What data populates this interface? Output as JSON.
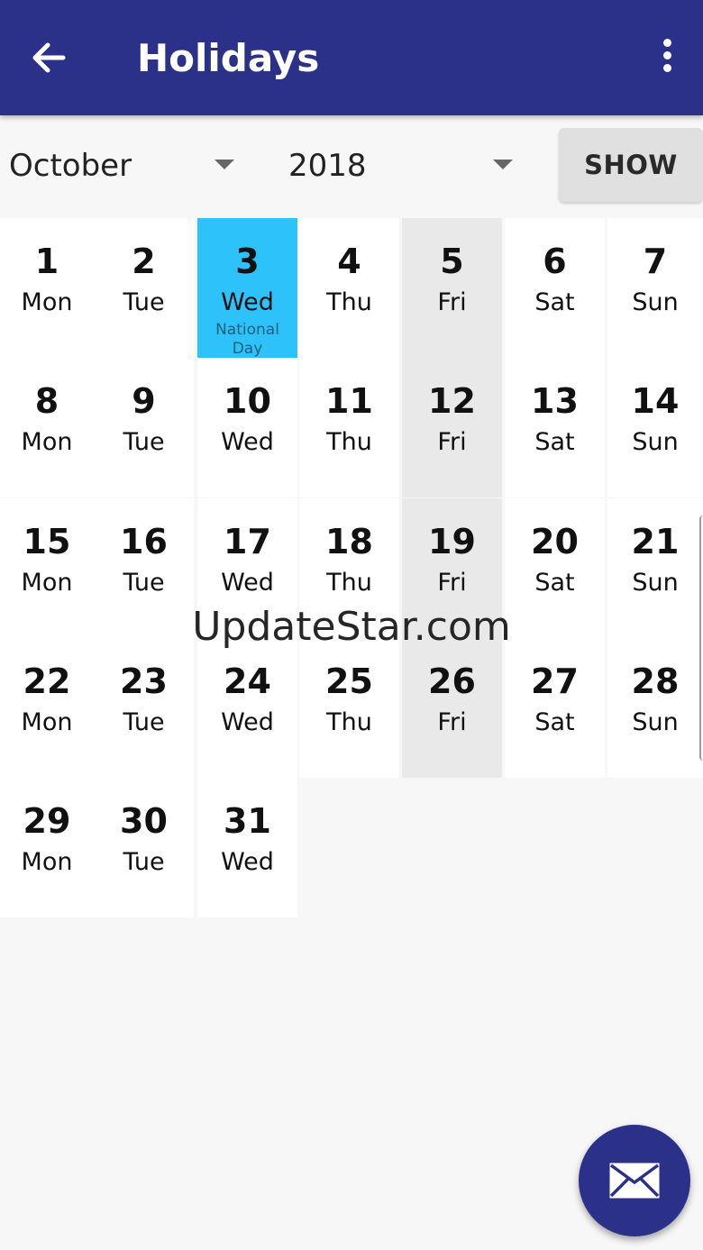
{
  "app": {
    "title": "Holidays"
  },
  "filters": {
    "month": "October",
    "year": "2018",
    "show_label": "SHOW"
  },
  "calendar": {
    "days": [
      {
        "num": "1",
        "dow": "Mon",
        "type": "normal",
        "note": ""
      },
      {
        "num": "2",
        "dow": "Tue",
        "type": "normal",
        "note": ""
      },
      {
        "num": "3",
        "dow": "Wed",
        "type": "holiday",
        "note": "National Day"
      },
      {
        "num": "4",
        "dow": "Thu",
        "type": "normal",
        "note": ""
      },
      {
        "num": "5",
        "dow": "Fri",
        "type": "weekend",
        "note": ""
      },
      {
        "num": "6",
        "dow": "Sat",
        "type": "normal",
        "note": ""
      },
      {
        "num": "7",
        "dow": "Sun",
        "type": "normal",
        "note": ""
      },
      {
        "num": "8",
        "dow": "Mon",
        "type": "normal",
        "note": ""
      },
      {
        "num": "9",
        "dow": "Tue",
        "type": "normal",
        "note": ""
      },
      {
        "num": "10",
        "dow": "Wed",
        "type": "normal",
        "note": ""
      },
      {
        "num": "11",
        "dow": "Thu",
        "type": "normal",
        "note": ""
      },
      {
        "num": "12",
        "dow": "Fri",
        "type": "weekend",
        "note": ""
      },
      {
        "num": "13",
        "dow": "Sat",
        "type": "normal",
        "note": ""
      },
      {
        "num": "14",
        "dow": "Sun",
        "type": "normal",
        "note": ""
      },
      {
        "num": "15",
        "dow": "Mon",
        "type": "normal",
        "note": ""
      },
      {
        "num": "16",
        "dow": "Tue",
        "type": "normal",
        "note": ""
      },
      {
        "num": "17",
        "dow": "Wed",
        "type": "normal",
        "note": ""
      },
      {
        "num": "18",
        "dow": "Thu",
        "type": "normal",
        "note": ""
      },
      {
        "num": "19",
        "dow": "Fri",
        "type": "weekend",
        "note": ""
      },
      {
        "num": "20",
        "dow": "Sat",
        "type": "normal",
        "note": ""
      },
      {
        "num": "21",
        "dow": "Sun",
        "type": "normal",
        "note": ""
      },
      {
        "num": "22",
        "dow": "Mon",
        "type": "normal",
        "note": ""
      },
      {
        "num": "23",
        "dow": "Tue",
        "type": "normal",
        "note": ""
      },
      {
        "num": "24",
        "dow": "Wed",
        "type": "normal",
        "note": ""
      },
      {
        "num": "25",
        "dow": "Thu",
        "type": "normal",
        "note": ""
      },
      {
        "num": "26",
        "dow": "Fri",
        "type": "weekend",
        "note": ""
      },
      {
        "num": "27",
        "dow": "Sat",
        "type": "normal",
        "note": ""
      },
      {
        "num": "28",
        "dow": "Sun",
        "type": "normal",
        "note": ""
      },
      {
        "num": "29",
        "dow": "Mon",
        "type": "normal",
        "note": ""
      },
      {
        "num": "30",
        "dow": "Tue",
        "type": "normal",
        "note": ""
      },
      {
        "num": "31",
        "dow": "Wed",
        "type": "normal",
        "note": ""
      }
    ]
  },
  "watermark": "UpdateStar.com",
  "icons": {
    "back": "arrow-back-icon",
    "menu": "more-vert-icon",
    "fab": "mail-icon",
    "dropdown": "caret-down-icon"
  },
  "colors": {
    "app_bar": "#2b3088",
    "holiday": "#2ec2fb",
    "weekend": "#e9e9e9",
    "fab": "#2b3088"
  }
}
